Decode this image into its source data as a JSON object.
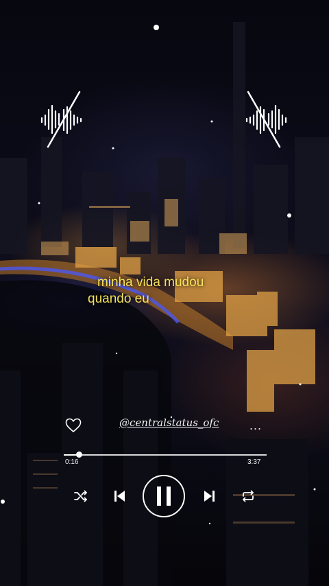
{
  "lyrics": {
    "line1": "minha vida mudou",
    "line2": "quando eu"
  },
  "player": {
    "handle": "@centralstatus_ofc",
    "more_label": "...",
    "elapsed": "0:16",
    "total": "3:37",
    "progress": 0.074,
    "liked": false,
    "playing": true
  },
  "icons": {
    "heart": "heart-icon",
    "shuffle": "shuffle-icon",
    "previous": "skip-previous-icon",
    "pause": "pause-icon",
    "next": "skip-next-icon",
    "repeat": "repeat-icon",
    "waveform": "sound-wave-icon"
  },
  "colors": {
    "lyrics": "#f4e15a",
    "controls": "#ffffff"
  }
}
